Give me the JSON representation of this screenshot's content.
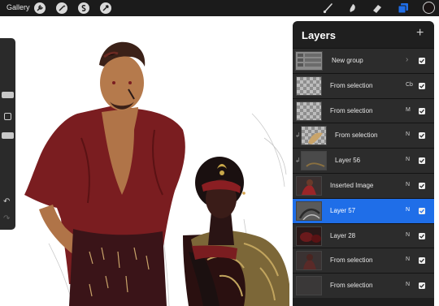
{
  "topbar": {
    "gallery_label": "Gallery",
    "left_tools": [
      "wrench-icon",
      "magic-wand-icon",
      "selection-icon",
      "transform-icon"
    ],
    "right_tools": [
      "brush-icon",
      "smudge-icon",
      "eraser-icon",
      "layers-icon"
    ],
    "accent": "#1f6ee8",
    "current_color": "#1a1414"
  },
  "sidebar": {
    "undo_icon": "undo-icon",
    "redo_icon": "redo-icon"
  },
  "layers_panel": {
    "title": "Layers",
    "add_label": "+",
    "layers": [
      {
        "name": "New group",
        "mode": "",
        "group": true,
        "clipped": false,
        "selected": false,
        "visible": true
      },
      {
        "name": "From selection",
        "mode": "Cb",
        "clipped": false,
        "selected": false,
        "visible": true
      },
      {
        "name": "From selection",
        "mode": "M",
        "clipped": false,
        "selected": false,
        "visible": true
      },
      {
        "name": "From selection",
        "mode": "N",
        "clipped": true,
        "selected": false,
        "visible": true
      },
      {
        "name": "Layer 56",
        "mode": "N",
        "clipped": true,
        "selected": false,
        "visible": true
      },
      {
        "name": "Inserted Image",
        "mode": "N",
        "clipped": false,
        "selected": false,
        "visible": true
      },
      {
        "name": "Layer 57",
        "mode": "N",
        "clipped": false,
        "selected": true,
        "visible": true
      },
      {
        "name": "Layer 28",
        "mode": "N",
        "clipped": false,
        "selected": false,
        "visible": true
      },
      {
        "name": "From selection",
        "mode": "N",
        "clipped": false,
        "selected": false,
        "visible": true
      },
      {
        "name": "From selection",
        "mode": "N",
        "clipped": false,
        "selected": false,
        "visible": true
      }
    ]
  }
}
